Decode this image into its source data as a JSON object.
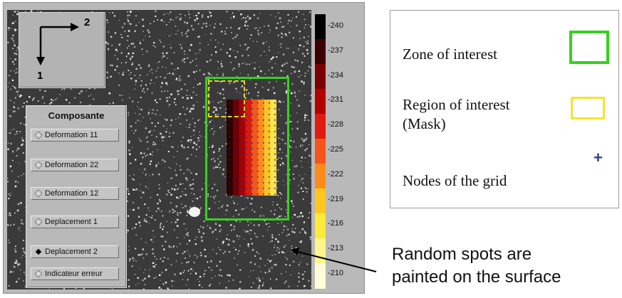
{
  "axes": {
    "axis_1": "1",
    "axis_2": "2"
  },
  "panel": {
    "title": "Composante",
    "options": [
      {
        "label": "Deformation 11",
        "selected": false
      },
      {
        "label": "Deformation 22",
        "selected": false
      },
      {
        "label": "Deformation 12",
        "selected": false
      },
      {
        "label": "Deplacement 1",
        "selected": false
      },
      {
        "label": "Deplacement 2",
        "selected": true
      },
      {
        "label": "Indicateur erreur",
        "selected": false
      }
    ]
  },
  "colorbar": {
    "ticks": [
      "-240",
      "-237",
      "-234",
      "-231",
      "-228",
      "-225",
      "-222",
      "-219",
      "-216",
      "-213",
      "-210"
    ],
    "colors": [
      "#000000",
      "#3a0000",
      "#7a0000",
      "#b30000",
      "#e01b10",
      "#f5551a",
      "#ff8c1a",
      "#ffc61f",
      "#ffe93a",
      "#fff58a",
      "#fffcd8"
    ]
  },
  "legend": {
    "zone_label": "Zone of interest",
    "region_label_line1": "Region of interest",
    "region_label_line2": "(Mask)",
    "nodes_label": "Nodes of the grid",
    "zone_color": "#35d11f",
    "region_color": "#f3e430",
    "node_color": "#2a3fa0"
  },
  "annotation": {
    "line1": "Random spots are",
    "line2": "painted on the surface"
  }
}
